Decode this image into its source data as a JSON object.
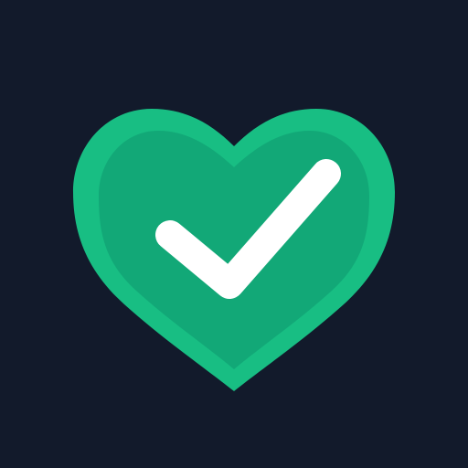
{
  "icon": {
    "name": "heart-check-icon",
    "colors": {
      "background": "#121A2B",
      "heart_outer": "#18BE83",
      "heart_inner": "#12A877",
      "check": "#FFFFFF"
    }
  }
}
